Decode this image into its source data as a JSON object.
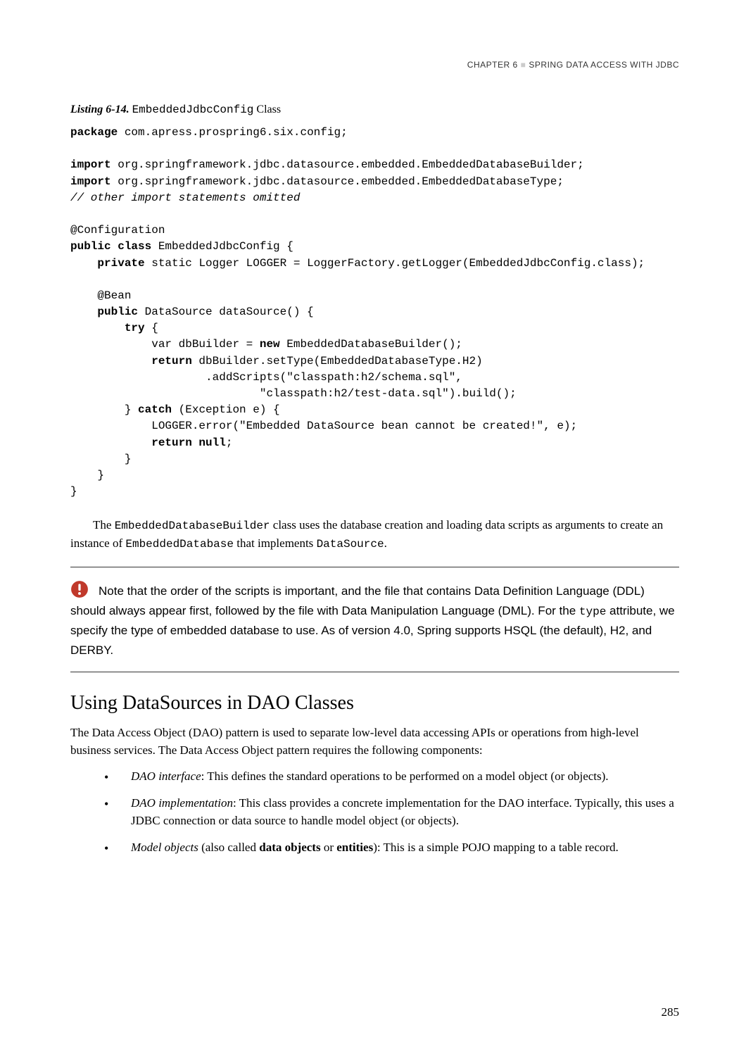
{
  "header": {
    "chapter": "CHAPTER 6",
    "title": "SPRING DATA ACCESS WITH JDBC"
  },
  "listing": {
    "label": "Listing 6-14.",
    "class_name": "EmbeddedJdbcConfig",
    "suffix": "Class"
  },
  "code": {
    "line1_kw": "package",
    "line1_rest": " com.apress.prospring6.six.config;",
    "line3_kw": "import",
    "line3_rest": " org.springframework.jdbc.datasource.embedded.EmbeddedDatabaseBuilder;",
    "line4_kw": "import",
    "line4_rest": " org.springframework.jdbc.datasource.embedded.EmbeddedDatabaseType;",
    "line5_comment": "// other import statements omitted",
    "line7": "@Configuration",
    "line8_kw1": "public class",
    "line8_rest": " EmbeddedJdbcConfig {",
    "line9_pad": "    ",
    "line9_kw": "private",
    "line9_rest": " static Logger LOGGER = LoggerFactory.getLogger(EmbeddedJdbcConfig.class);",
    "line11_pad": "    ",
    "line11": "@Bean",
    "line12_pad": "    ",
    "line12_kw": "public",
    "line12_rest": " DataSource dataSource() {",
    "line13_pad": "        ",
    "line13_kw": "try",
    "line13_rest": " {",
    "line14_pad": "            ",
    "line14_a": "var dbBuilder = ",
    "line14_kw": "new",
    "line14_b": " EmbeddedDatabaseBuilder();",
    "line15_pad": "            ",
    "line15_kw": "return",
    "line15_rest": " dbBuilder.setType(EmbeddedDatabaseType.H2)",
    "line16": "                    .addScripts(\"classpath:h2/schema.sql\",",
    "line17": "                            \"classpath:h2/test-data.sql\").build();",
    "line18_pad": "        ",
    "line18_a": "} ",
    "line18_kw": "catch",
    "line18_b": " (Exception e) {",
    "line19": "            LOGGER.error(\"Embedded DataSource bean cannot be created!\", e);",
    "line20_pad": "            ",
    "line20_kw": "return null",
    "line20_b": ";",
    "line21": "        }",
    "line22": "    }",
    "line23": "}"
  },
  "para1": {
    "a": "The ",
    "m1": "EmbeddedDatabaseBuilder",
    "b": " class uses the database creation and loading data scripts as arguments to create an instance of ",
    "m2": "EmbeddedDatabase",
    "c": " that implements ",
    "m3": "DataSource",
    "d": "."
  },
  "note": {
    "a": "Note that the order of the scripts is important, and the file that contains Data Definition Language (DDL) should always appear first, followed by the file with Data Manipulation Language (DML). For the ",
    "m1": "type",
    "b": " attribute, we specify the type of embedded database to use. As of version 4.0, Spring supports HSQL (the default), H2, and DERBY."
  },
  "section": {
    "heading": "Using DataSources in DAO Classes",
    "intro": "The Data Access Object (DAO) pattern is used to separate low-level data accessing APIs or operations from high-level business services. The Data Access Object pattern requires the following components:",
    "items": [
      {
        "term": "DAO interface",
        "rest": ": This defines the standard operations to be performed on a model object (or objects)."
      },
      {
        "term": "DAO implementation",
        "rest": ": This class provides a concrete implementation for the DAO interface. Typically, this uses a JDBC connection or data source to handle model object (or objects)."
      },
      {
        "term": "Model objects",
        "mid": " (also called ",
        "bold1": "data objects",
        "or": " or ",
        "bold2": "entities",
        "rest": "): This is a simple POJO mapping to a table record."
      }
    ]
  },
  "page_number": "285"
}
